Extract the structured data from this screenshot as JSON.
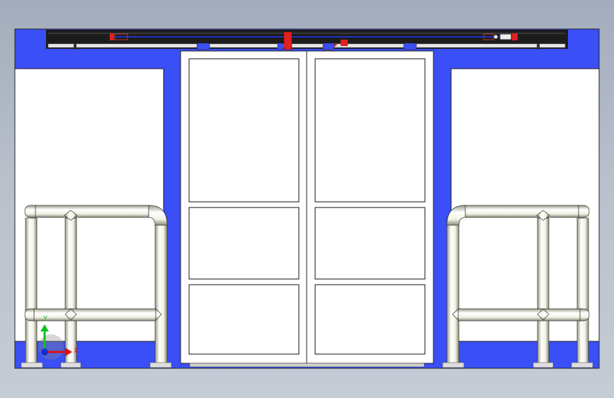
{
  "viewport": {
    "triad": {
      "x_label": "X",
      "y_label": "Y",
      "x_color": "#e01010",
      "y_color": "#10c020",
      "z_color": "#1030d0"
    },
    "colors": {
      "background_top": "#a2acbb",
      "background_bottom": "#c6ccd6",
      "wall_blue": "#3a4ff5",
      "panel_white": "#ffffff",
      "header_dark": "#1c1c1c",
      "marker_red": "#e02020"
    }
  }
}
